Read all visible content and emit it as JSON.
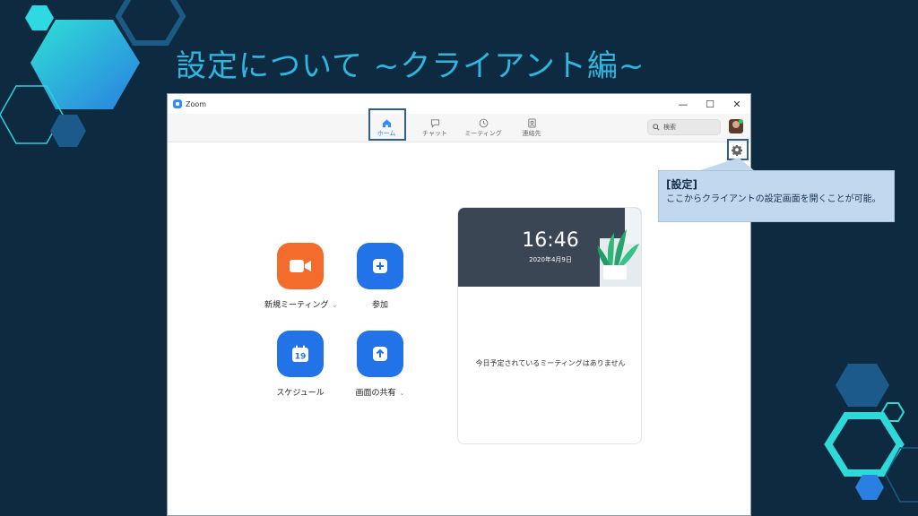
{
  "slide": {
    "title": "設定について ~クライアント編~"
  },
  "window": {
    "app_name": "Zoom",
    "controls": {
      "minimize": "—",
      "maximize": "☐",
      "close": "✕"
    }
  },
  "tabs": [
    {
      "label": "ホーム",
      "active": true
    },
    {
      "label": "チャット",
      "active": false
    },
    {
      "label": "ミーティング",
      "active": false
    },
    {
      "label": "連絡先",
      "active": false
    }
  ],
  "search": {
    "placeholder": "検索"
  },
  "actions": {
    "new_meeting": {
      "label": "新規ミーティング",
      "caret": "⌄"
    },
    "join": {
      "label": "参加"
    },
    "schedule": {
      "label": "スケジュール",
      "calendar_day": "19"
    },
    "share": {
      "label": "画面の共有",
      "caret": "⌄"
    }
  },
  "clock_card": {
    "time": "16:46",
    "date": "2020年4月9日",
    "empty_message": "今日予定されているミーティングはありません"
  },
  "callout": {
    "title": "[設定]",
    "body": "ここからクライアントの設定画面を開くことが可能。"
  },
  "colors": {
    "background": "#0d2a40",
    "title": "#2fb6e0",
    "zoom_blue": "#2272e8",
    "zoom_orange": "#f46c2b",
    "callout_bg": "#c2d8ef",
    "highlight": "#2f5f8f"
  },
  "icons": [
    "home-icon",
    "chat-icon",
    "clock-icon",
    "contacts-icon",
    "search-icon",
    "gear-icon",
    "video-camera-icon",
    "plus-icon",
    "calendar-icon",
    "share-arrow-icon"
  ]
}
